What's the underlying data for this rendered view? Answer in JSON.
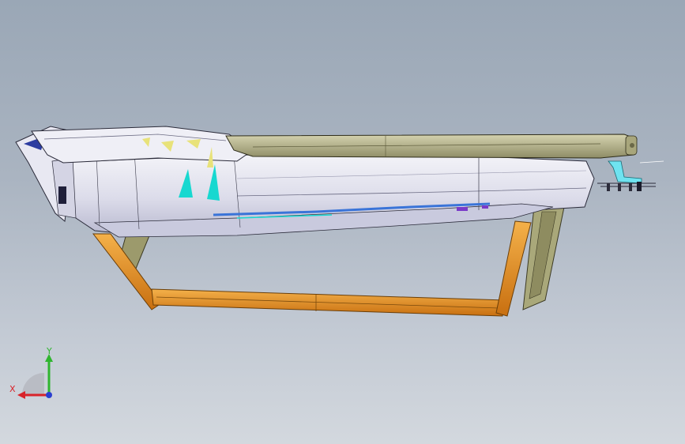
{
  "window": {
    "title": "",
    "background_top": "#9aa7b6",
    "background_bottom": "#d3d8de"
  },
  "model": {
    "body_color": "#e6e6f0",
    "body_shade": "#c7c8db",
    "rail_color": "#b2b08c",
    "frame_color": "#e8911e",
    "frame_edge": "#8a5410",
    "accent_cyan": "#18d8d0",
    "accent_yellow": "#e8e27a",
    "accent_blue": "#3a74d8",
    "accent_purple": "#7a3ac8"
  },
  "triad": {
    "x_label": "X",
    "y_label": "Y",
    "x_color": "#d8232a",
    "y_color": "#2fb52f",
    "z_color": "#2a3fd0"
  }
}
